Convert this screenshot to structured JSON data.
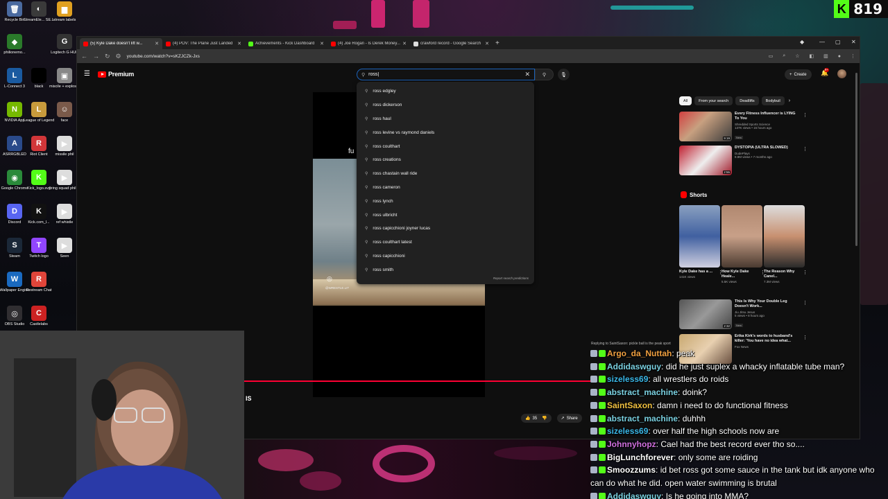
{
  "kick_badge": {
    "count": "819"
  },
  "desktop_icons": [
    {
      "label": "Recycle Bin",
      "color": "#4a6aa0",
      "glyph": "🗑"
    },
    {
      "label": "StreamEle... SE.Live",
      "color": "#3a3a3a",
      "glyph": "◐"
    },
    {
      "label": "stream labels",
      "color": "#e0a020",
      "glyph": "▆"
    },
    {
      "label": "philionemo...",
      "color": "#2a7a2a",
      "glyph": "◆"
    },
    {
      "label": "Logitech G HUB",
      "color": "#333333",
      "glyph": "G"
    },
    {
      "label": "L-Connect 3",
      "color": "#1a5aa0",
      "glyph": "L"
    },
    {
      "label": "black",
      "color": "#000000",
      "glyph": " "
    },
    {
      "label": "miscile + explosion ...",
      "color": "#888888",
      "glyph": "▣"
    },
    {
      "label": "NVIDIA App",
      "color": "#76b900",
      "glyph": "N"
    },
    {
      "label": "League of Legends",
      "color": "#c89b3c",
      "glyph": "L"
    },
    {
      "label": "face",
      "color": "#7a5a4a",
      "glyph": "☺"
    },
    {
      "label": "ASRRGBLED",
      "color": "#2a4a8a",
      "glyph": "A"
    },
    {
      "label": "Riot Client",
      "color": "#d13639",
      "glyph": "R"
    },
    {
      "label": "missile phil",
      "color": "#dddddd",
      "glyph": "▶"
    },
    {
      "label": "Google Chrome",
      "color": "#2a8a3a",
      "glyph": "◉"
    },
    {
      "label": "Kick_logo.svg",
      "color": "#53fc18",
      "glyph": "K"
    },
    {
      "label": "firing squad phil (1)",
      "color": "#dddddd",
      "glyph": "▶"
    },
    {
      "label": "Discord",
      "color": "#5865f2",
      "glyph": "D"
    },
    {
      "label": "Kick.com_l...",
      "color": "#111111",
      "glyph": "K"
    },
    {
      "label": "ref whistle",
      "color": "#dddddd",
      "glyph": "▶"
    },
    {
      "label": "Steam",
      "color": "#1b2838",
      "glyph": "S"
    },
    {
      "label": "Twitch logo",
      "color": "#9146ff",
      "glyph": "T"
    },
    {
      "label": "Seen",
      "color": "#dddddd",
      "glyph": "▶"
    },
    {
      "label": "Wallpaper Engine",
      "color": "#1a6ac0",
      "glyph": "W"
    },
    {
      "label": "Restream Chat",
      "color": "#e0453a",
      "glyph": "R"
    },
    {
      "label": "OBS Studio",
      "color": "#302e31",
      "glyph": "◎"
    },
    {
      "label": "Castlelabs",
      "color": "#cc2222",
      "glyph": "C"
    }
  ],
  "browser": {
    "tabs": [
      {
        "title": "(5) Kyle Dake doesn't lift w...",
        "color": "#ff0000",
        "active": true
      },
      {
        "title": "(4) POV: The Plane Just Landed",
        "color": "#ff0000",
        "active": false
      },
      {
        "title": "Achievements - Kick Dashboard",
        "color": "#53fc18",
        "active": false
      },
      {
        "title": "(4) Joe Rogan - Is Derek Money...",
        "color": "#ff0000",
        "active": false
      },
      {
        "title": "crawford record - Google Search",
        "color": "#dddddd",
        "active": false
      }
    ],
    "new_tab": "+",
    "url": "youtube.com/watch?v=sKZJCZk-Jxs"
  },
  "youtube": {
    "logo_text": "Premium",
    "search": {
      "value": "ross|"
    },
    "create_label": "Create",
    "notif_count": "9+",
    "suggestions": [
      "ross edgley",
      "ross dickerson",
      "ross haul",
      "ross levine vs raymond daniels",
      "ross coulthart",
      "ross creations",
      "ross chastain wall ride",
      "ross cameron",
      "ross lynch",
      "ross ulbricht",
      "ross capicchioni joyner lucas",
      "ross coulthart latest",
      "ross capicchioni",
      "ross smith"
    ],
    "report_label": "Report search predictions",
    "player": {
      "caption": "fu",
      "handle": "@WRESTLE.LIT"
    },
    "video_title_tail": "IS",
    "like_count": "35",
    "share_label": "Share",
    "chips": [
      "All",
      "From your search",
      "Deadlifts",
      "Bodybuil"
    ],
    "recommended": [
      {
        "title": "Every Fitness Influencer is LYING To You",
        "channel": "Shredded Sports Science",
        "views": "137K views • 15 hours ago",
        "badge": "New",
        "duration": "9:19"
      },
      {
        "title": "DYSTOPIA (ULTRA SLOWED)",
        "channel": "DudePlays",
        "views": "8.8M views • 7 months ago",
        "badge": "",
        "duration": "2:55"
      }
    ],
    "shorts_label": "Shorts",
    "shorts": [
      {
        "title": "Kyle Dake has a ...",
        "views": "141K views"
      },
      {
        "title": "How Kyle Dake Heale...",
        "views": "5.5K views"
      },
      {
        "title": "The Reason Why Canel...",
        "views": "7.3M views"
      }
    ],
    "recommended_lower": [
      {
        "title": "This Is Why Your Double Leg Doesn't Work...",
        "channel": "Jiu Jitsu Jesus",
        "views": "5 views • 8 hours ago",
        "badge": "New",
        "duration": "2:32"
      },
      {
        "title": "Erika Kirk's words to husband's killer: 'You have no idea what...",
        "channel": "Fox News",
        "views": "",
        "badge": "",
        "duration": ""
      }
    ]
  },
  "chat": {
    "reply_header": "Replying to SaintSaxon: pickle ball is the peak sport",
    "messages": [
      {
        "user": "Argo_da_Nuttah",
        "color": "#f0a040",
        "text": "peak"
      },
      {
        "user": "Addidaswguy",
        "color": "#7ad0e0",
        "text": "did he just suplex a whacky inflatable tube man?"
      },
      {
        "user": "sizeless69",
        "color": "#3ab8e8",
        "text": "all wrestlers do roids"
      },
      {
        "user": "abstract_machine",
        "color": "#7ad0e0",
        "text": "doink?"
      },
      {
        "user": "SaintSaxon",
        "color": "#f0c040",
        "text": "damn i need to do functional fitness"
      },
      {
        "user": "abstract_machine",
        "color": "#7ad0e0",
        "text": "duhhh"
      },
      {
        "user": "sizeless69",
        "color": "#3ab8e8",
        "text": "over half the high schools now are"
      },
      {
        "user": "Johnnyhopz",
        "color": "#d070e0",
        "text": "Cael had the best record ever tho so...."
      },
      {
        "user": "BigLunchforever",
        "color": "#ffffff",
        "text": "only some are roiding"
      },
      {
        "user": "Smoozzums",
        "color": "#ffffff",
        "text": "id bet ross got some sauce in the tank but idk anyone who can do what he did. open water swimming is brutal"
      },
      {
        "user": "Addidaswguy",
        "color": "#7ad0e0",
        "text": "Is he going into MMA?"
      }
    ]
  }
}
